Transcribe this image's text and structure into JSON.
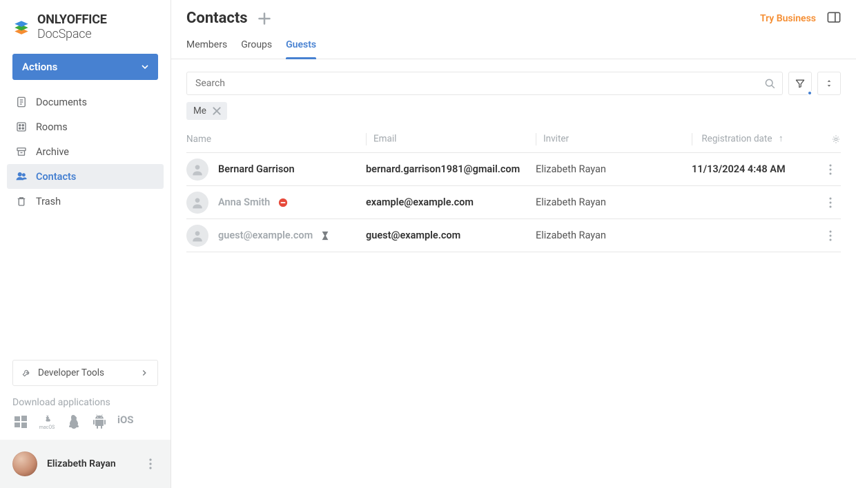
{
  "brand": {
    "bold": "ONLYOFFICE",
    "sub": " DocSpace"
  },
  "sidebar": {
    "actions_label": "Actions",
    "items": [
      {
        "label": "Documents"
      },
      {
        "label": "Rooms"
      },
      {
        "label": "Archive"
      },
      {
        "label": "Contacts"
      },
      {
        "label": "Trash"
      }
    ],
    "dev_tools_label": "Developer Tools",
    "download_label": "Download applications"
  },
  "user": {
    "name": "Elizabeth Rayan"
  },
  "header": {
    "title": "Contacts",
    "try_business": "Try Business"
  },
  "tabs": [
    {
      "label": "Members"
    },
    {
      "label": "Groups"
    },
    {
      "label": "Guests"
    }
  ],
  "search": {
    "placeholder": "Search"
  },
  "chips": [
    {
      "label": "Me"
    }
  ],
  "columns": {
    "name": "Name",
    "email": "Email",
    "inviter": "Inviter",
    "date": "Registration date"
  },
  "rows": [
    {
      "name": "Bernard Garrison",
      "email": "bernard.garrison1981@gmail.com",
      "inviter": "Elizabeth Rayan",
      "date": "11/13/2024 4:48 AM",
      "muted": false,
      "emailStrong": true,
      "status": null
    },
    {
      "name": "Anna Smith",
      "email": "example@example.com",
      "inviter": "Elizabeth Rayan",
      "date": "",
      "muted": true,
      "emailStrong": true,
      "status": "blocked"
    },
    {
      "name": "guest@example.com",
      "email": "guest@example.com",
      "inviter": "Elizabeth Rayan",
      "date": "",
      "muted": true,
      "emailStrong": true,
      "status": "pending"
    }
  ]
}
